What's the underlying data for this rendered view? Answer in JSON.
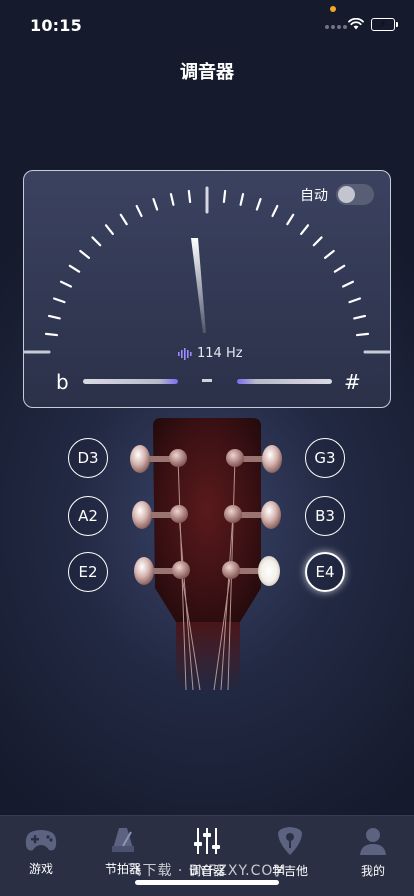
{
  "status_bar": {
    "time": "10:15",
    "battery_level": 1.0
  },
  "header": {
    "title": "调音器"
  },
  "tuner": {
    "auto_label": "自动",
    "auto_enabled": false,
    "frequency": "114 Hz",
    "flat_symbol": "b",
    "sharp_symbol": "#",
    "center_marker": "-",
    "needle_cents": 0
  },
  "strings": {
    "left": [
      "D3",
      "A2",
      "E2"
    ],
    "right": [
      "G3",
      "B3",
      "E4"
    ],
    "selected": "E4"
  },
  "tabbar": {
    "items": [
      {
        "label": "游戏",
        "icon": "gamepad-icon"
      },
      {
        "label": "节拍器",
        "icon": "metronome-icon"
      },
      {
        "label": "调音器",
        "icon": "tuner-sliders-icon"
      },
      {
        "label": "学吉他",
        "icon": "guitar-pick-icon"
      },
      {
        "label": "我的",
        "icon": "user-icon"
      }
    ],
    "active_index": 2
  },
  "watermark": "飞下载 · BYFZXY.COM",
  "colors": {
    "accent": "#7a6cf0",
    "battery": "#4cd964",
    "notification_dot": "#f5a623"
  }
}
